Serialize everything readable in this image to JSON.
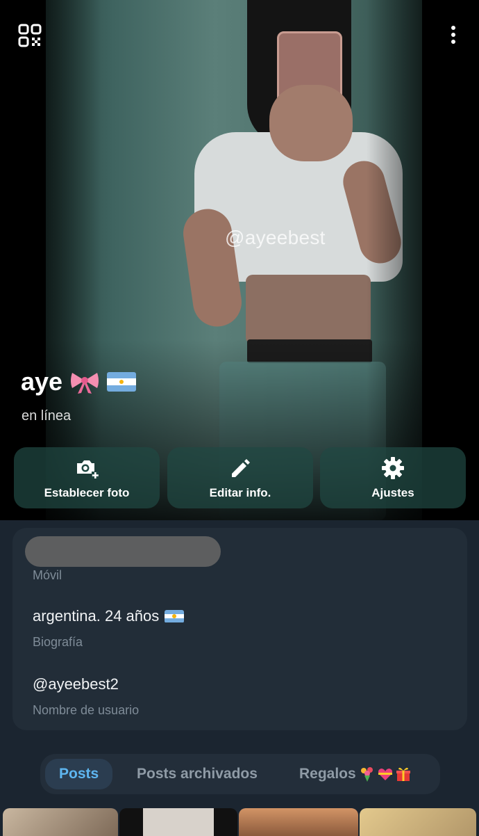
{
  "header": {
    "watermark": "@ayeebest",
    "name": "aye",
    "status": "en línea",
    "icons": [
      "qr-code-icon",
      "more-vertical-icon"
    ]
  },
  "actions": [
    {
      "label": "Establecer foto",
      "icon": "camera-add-icon"
    },
    {
      "label": "Editar info.",
      "icon": "pencil-icon"
    },
    {
      "label": "Ajustes",
      "icon": "gear-icon"
    }
  ],
  "info": {
    "phone_label": "Móvil",
    "bio_value": "argentina. 24 años",
    "bio_label": "Biografía",
    "username_value": "@ayeebest2",
    "username_label": "Nombre de usuario"
  },
  "tabs": {
    "posts": "Posts",
    "archived": "Posts archivados",
    "gifts": "Regalos"
  },
  "colors": {
    "background": "#1b2530",
    "card": "#222d38",
    "accent": "#5eb6f0",
    "action_bg": "#204842"
  }
}
